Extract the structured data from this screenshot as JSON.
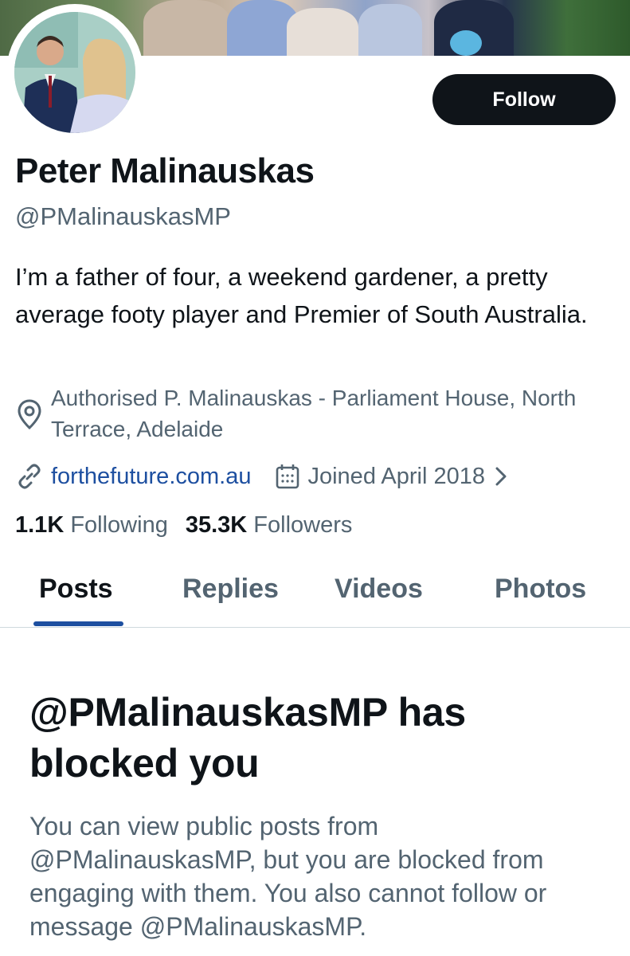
{
  "profile": {
    "name": "Peter Malinauskas",
    "handle": "@PMalinauskasMP",
    "bio": "I’m a father of four, a weekend gardener, a pretty average footy player and Premier of South Australia.",
    "location": "Authorised P. Malinauskas - Parliament House, North Terrace, Adelaide",
    "website": "forthefuture.com.au",
    "joined": "Joined April 2018",
    "following_count": "1.1K",
    "following_label": "Following",
    "followers_count": "35.3K",
    "followers_label": "Followers"
  },
  "follow_button": {
    "label": "Follow"
  },
  "tabs": [
    {
      "label": "Posts",
      "active": true
    },
    {
      "label": "Replies",
      "active": false
    },
    {
      "label": "Videos",
      "active": false
    },
    {
      "label": "Photos",
      "active": false
    }
  ],
  "blocked_notice": {
    "title": "@PMalinauskasMP has blocked you",
    "message": "You can view public posts from @PMalinauskasMP, but you are blocked from engaging with them. You also cannot follow or message @PMalinauskasMP."
  },
  "icons": {
    "location": "location-pin-icon",
    "link": "link-icon",
    "calendar": "calendar-icon",
    "chevron": "chevron-right-icon"
  },
  "colors": {
    "accent": "#1d4fa0",
    "text_primary": "#0f1419",
    "text_secondary": "#536471",
    "button_bg": "#0f1419"
  }
}
